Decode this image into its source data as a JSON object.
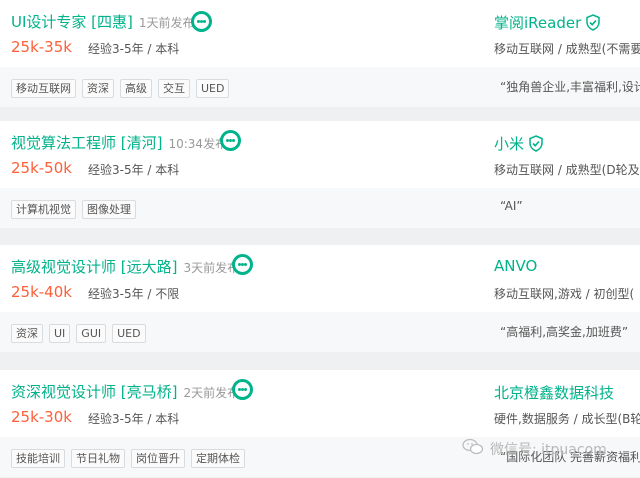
{
  "jobs": [
    {
      "title": "UI设计专家 [四惠]",
      "time": "1天前发布",
      "salary": "25k-35k",
      "requirements": "经验3-5年 / 本科",
      "tags": [
        "移动互联网",
        "资深",
        "高级",
        "交互",
        "UED"
      ],
      "company": "掌阅iReader",
      "verified": true,
      "industry": "移动互联网 / 成熟型(不需要",
      "slogan": "“独角兽企业,丰富福利,设计"
    },
    {
      "title": "视觉算法工程师 [清河]",
      "time": "10:34发布",
      "salary": "25k-50k",
      "requirements": "经验3-5年 / 本科",
      "tags": [
        "计算机视觉",
        "图像处理"
      ],
      "company": "小米",
      "verified": true,
      "industry": "移动互联网 / 成熟型(D轮及",
      "slogan": "“AI”"
    },
    {
      "title": "高级视觉设计师 [远大路]",
      "time": "3天前发布",
      "salary": "25k-40k",
      "requirements": "经验3-5年 / 不限",
      "tags": [
        "资深",
        "UI",
        "GUI",
        "UED"
      ],
      "company": "ANVO",
      "verified": false,
      "industry": "移动互联网,游戏 / 初创型(",
      "slogan": "“高福利,高奖金,加班费”"
    },
    {
      "title": "资深视觉设计师 [亮马桥]",
      "time": "2天前发布",
      "salary": "25k-30k",
      "requirements": "经验3-5年 / 本科",
      "tags": [
        "技能培训",
        "节日礼物",
        "岗位晋升",
        "定期体检"
      ],
      "company": "北京橙鑫数据科技",
      "verified": false,
      "industry": "硬件,数据服务 / 成长型(B轮",
      "slogan": "“国际化团队 完善薪资福利"
    }
  ],
  "watermark": {
    "text": "微信号: itpuacom"
  },
  "colors": {
    "accent": "#00b38a",
    "salary": "#fd5f39",
    "text": "#555555",
    "muted": "#999999"
  },
  "icons": {
    "chat": "chat-bubble-icon",
    "verified": "shield-check-icon",
    "wechat": "wechat-icon"
  }
}
